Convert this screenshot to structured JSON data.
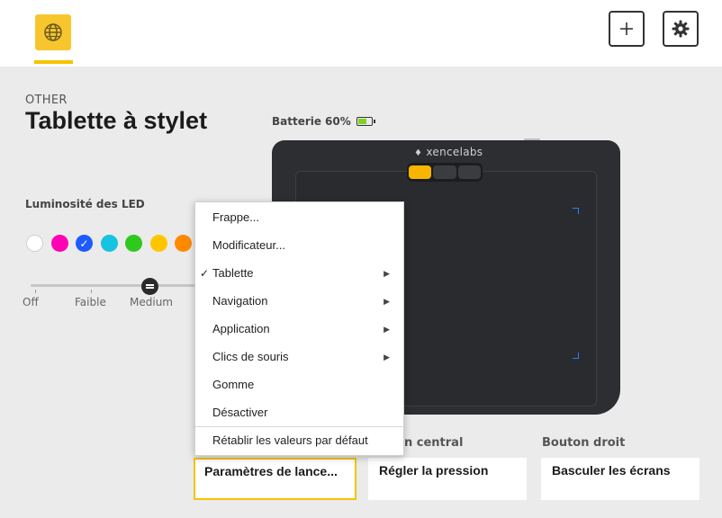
{
  "header": {
    "active_tab_icon": "globe-icon",
    "add_button_icon": "plus-icon",
    "settings_button_icon": "gear-icon",
    "accent_color": "#f7c300"
  },
  "page": {
    "category": "OTHER",
    "title": "Tablette à stylet"
  },
  "battery": {
    "label": "Batterie",
    "percent": "60%",
    "level": 0.6,
    "bar_color": "#7ed321"
  },
  "led": {
    "label": "Luminosité des LED",
    "colors": [
      "#ffffff",
      "#ff00b4",
      "#1d5bff",
      "#16c3e0",
      "#2ec81f",
      "#ffc600",
      "#ff8a00"
    ],
    "selected_index": 2,
    "slider": {
      "labels": [
        "Off",
        "Faible",
        "Medium"
      ],
      "selected": "Medium"
    }
  },
  "device": {
    "brand": "xencelabs"
  },
  "context_menu": {
    "items": [
      {
        "label": "Frappe...",
        "checked": false,
        "submenu": false
      },
      {
        "label": "Modificateur...",
        "checked": false,
        "submenu": false
      },
      {
        "label": "Tablette",
        "checked": true,
        "submenu": true
      },
      {
        "label": "Navigation",
        "checked": false,
        "submenu": true
      },
      {
        "label": "Application",
        "checked": false,
        "submenu": true
      },
      {
        "label": "Clics de souris",
        "checked": false,
        "submenu": true
      },
      {
        "label": "Gomme",
        "checked": false,
        "submenu": false
      },
      {
        "label": "Désactiver",
        "checked": false,
        "submenu": false
      }
    ],
    "reset_label": "Rétablir les valeurs par défaut",
    "check_glyph": "✓",
    "arrow_glyph": "▶"
  },
  "buttons": {
    "middle_heading_visible": "n central",
    "right_heading": "Bouton droit",
    "left_value": "Paramètres de lance...",
    "middle_value": "Régler la pression",
    "right_value": "Basculer les écrans"
  }
}
